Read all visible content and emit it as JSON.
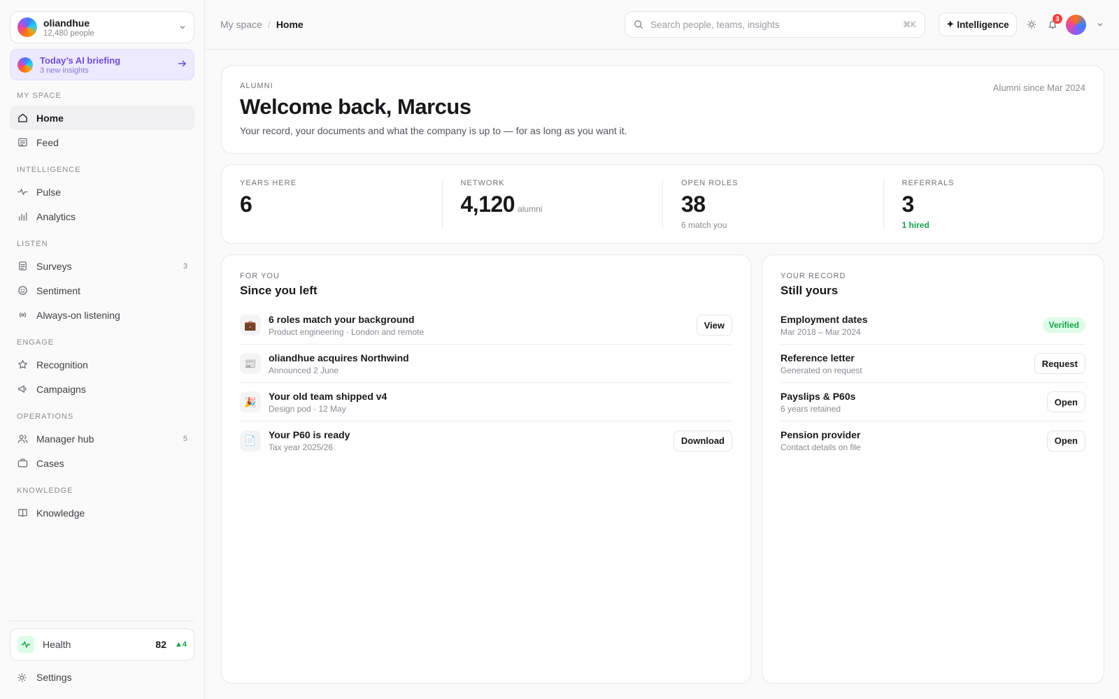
{
  "org": {
    "name": "oliandhue",
    "people": "12,480 people"
  },
  "briefing": {
    "title": "Today’s AI briefing",
    "sub": "3 new insights"
  },
  "sidebar": {
    "sections": [
      {
        "label": "MY SPACE",
        "items": [
          {
            "label": "Home",
            "icon": "home-icon",
            "active": true
          },
          {
            "label": "Feed",
            "icon": "feed-icon"
          }
        ]
      },
      {
        "label": "INTELLIGENCE",
        "items": [
          {
            "label": "Pulse",
            "icon": "pulse-icon"
          },
          {
            "label": "Analytics",
            "icon": "bar-chart-icon"
          }
        ]
      },
      {
        "label": "LISTEN",
        "items": [
          {
            "label": "Surveys",
            "icon": "survey-icon",
            "count": "3"
          },
          {
            "label": "Sentiment",
            "icon": "smile-icon"
          },
          {
            "label": "Always-on listening",
            "icon": "broadcast-icon"
          }
        ]
      },
      {
        "label": "ENGAGE",
        "items": [
          {
            "label": "Recognition",
            "icon": "star-icon"
          },
          {
            "label": "Campaigns",
            "icon": "megaphone-icon"
          }
        ]
      },
      {
        "label": "OPERATIONS",
        "items": [
          {
            "label": "Manager hub",
            "icon": "users-icon",
            "count": "5"
          },
          {
            "label": "Cases",
            "icon": "briefcase-icon"
          }
        ]
      },
      {
        "label": "KNOWLEDGE",
        "items": [
          {
            "label": "Knowledge",
            "icon": "book-icon"
          }
        ]
      }
    ],
    "health": {
      "label": "Health",
      "value": "82",
      "delta": "▲4"
    },
    "settings_label": "Settings"
  },
  "topbar": {
    "breadcrumb": [
      "My space",
      "Home"
    ],
    "search_placeholder": "Search people, teams, insights",
    "search_shortcut": "⌘K",
    "intelligence_label": "Intelligence",
    "notifications_count": "3"
  },
  "hero": {
    "eyebrow": "ALUMNI",
    "title": "Welcome back, Marcus",
    "description": "Your record, your documents and what the company is up to — for as long as you want it.",
    "since": "Alumni since Mar 2024"
  },
  "stats": [
    {
      "label": "YEARS HERE",
      "value": "6",
      "unit": "",
      "sub": ""
    },
    {
      "label": "NETWORK",
      "value": "4,120",
      "unit": "alumni",
      "sub": ""
    },
    {
      "label": "OPEN ROLES",
      "value": "38",
      "unit": "",
      "sub": "6 match you"
    },
    {
      "label": "REFERRALS",
      "value": "3",
      "unit": "",
      "sub": "1 hired",
      "sub_color": "#16a34a"
    }
  ],
  "for_you": {
    "eyebrow": "FOR YOU",
    "title": "Since you left",
    "items": [
      {
        "icon": "briefcase-emoji",
        "glyph": "💼",
        "title": "6 roles match your background",
        "sub": "Product engineering · London and remote",
        "action": "View"
      },
      {
        "icon": "newspaper-emoji",
        "glyph": "📰",
        "title": "oliandhue acquires Northwind",
        "sub": "Announced 2 June",
        "action": ""
      },
      {
        "icon": "party-emoji",
        "glyph": "🎉",
        "title": "Your old team shipped v4",
        "sub": "Design pod · 12 May",
        "action": ""
      },
      {
        "icon": "document-emoji",
        "glyph": "📄",
        "title": "Your P60 is ready",
        "sub": "Tax year 2025/26",
        "action": "Download"
      }
    ]
  },
  "record": {
    "eyebrow": "YOUR RECORD",
    "title": "Still yours",
    "items": [
      {
        "title": "Employment dates",
        "sub": "Mar 2018 – Mar 2024",
        "status": "Verified",
        "action": ""
      },
      {
        "title": "Reference letter",
        "sub": "Generated on request",
        "status": "",
        "action": "Request"
      },
      {
        "title": "Payslips & P60s",
        "sub": "6 years retained",
        "status": "",
        "action": "Open"
      },
      {
        "title": "Pension provider",
        "sub": "Contact details on file",
        "status": "",
        "action": "Open"
      }
    ]
  },
  "colors": {
    "accent": "#6d4fd8",
    "positive": "#16a34a",
    "danger": "#ef4444"
  }
}
